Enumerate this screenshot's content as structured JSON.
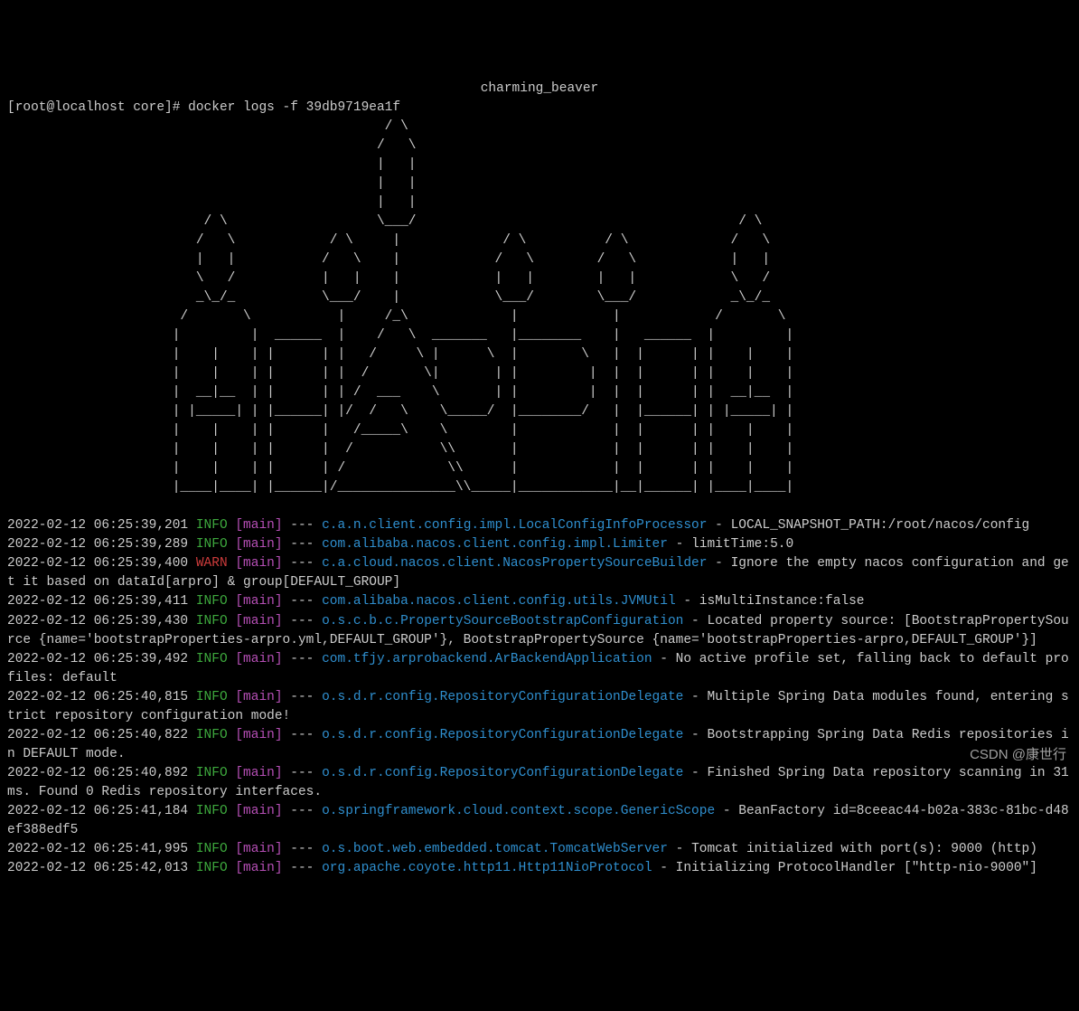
{
  "header_name": "charming_beaver",
  "prompt_left": "[root@localhost core]#",
  "prompt_cmd": "docker logs -f 39db9719ea1f",
  "ascii_art": "                                                / \\\n                                               /   \\\n                                               |   |\n                                               |   |\n                                               |   |\n                         / \\                   \\___/                                         / \\\n                        /   \\            / \\     |             / \\          / \\             /   \\\n                        |   |           /   \\    |            /   \\        /   \\            |   |\n                        \\   /           |   |    |            |   |        |   |            \\   /\n                        _\\_/_           \\___/    |            \\___/        \\___/            _\\_/_\n                      /       \\           |     /_\\             |            |            /       \\\n                     |         |  ______  |    /   \\  _______   |________    |   ______  |         |\n                     |    |    | |      | |   /     \\ |      \\  |        \\   |  |      | |    |    |\n                     |    |    | |      | |  /       \\|       | |         |  |  |      | |    |    |\n                     |  __|__  | |      | | /  ___    \\       | |         |  |  |      | |  __|__  |\n                     | |_____| | |______| |/  /   \\    \\_____/  |________/   |  |______| | |_____| |\n                     |    |    | |      |   /_____\\    \\        |            |  |      | |    |    |\n                     |    |    | |      |  /           \\\\       |            |  |      | |    |    |\n                     |    |    | |      | /             \\\\      |            |  |      | |    |    |\n                     |____|____| |______|/_______________\\\\_____|____________|__|______| |____|____|",
  "logs": [
    {
      "ts": "2022-02-12 06:25:39,201",
      "level": "INFO",
      "thread": "[main]",
      "sep": " --- ",
      "logger": "c.a.n.client.config.impl.LocalConfigInfoProcessor",
      "msg": " - LOCAL_SNAPSHOT_PATH:/root/nacos/config"
    },
    {
      "ts": "2022-02-12 06:25:39,289",
      "level": "INFO",
      "thread": "[main]",
      "sep": " --- ",
      "logger": "com.alibaba.nacos.client.config.impl.Limiter",
      "msg": " - limitTime:5.0"
    },
    {
      "ts": "2022-02-12 06:25:39,400",
      "level": "WARN",
      "thread": "[main]",
      "sep": " --- ",
      "logger": "c.a.cloud.nacos.client.NacosPropertySourceBuilder",
      "msg": " - Ignore the empty nacos configuration and get it based on dataId[arpro] & group[DEFAULT_GROUP]"
    },
    {
      "ts": "2022-02-12 06:25:39,411",
      "level": "INFO",
      "thread": "[main]",
      "sep": " --- ",
      "logger": "com.alibaba.nacos.client.config.utils.JVMUtil",
      "msg": " - isMultiInstance:false"
    },
    {
      "ts": "2022-02-12 06:25:39,430",
      "level": "INFO",
      "thread": "[main]",
      "sep": " --- ",
      "logger": "o.s.c.b.c.PropertySourceBootstrapConfiguration",
      "msg": " - Located property source: [BootstrapPropertySource {name='bootstrapProperties-arpro.yml,DEFAULT_GROUP'}, BootstrapPropertySource {name='bootstrapProperties-arpro,DEFAULT_GROUP'}]"
    },
    {
      "ts": "2022-02-12 06:25:39,492",
      "level": "INFO",
      "thread": "[main]",
      "sep": " --- ",
      "logger": "com.tfjy.arprobackend.ArBackendApplication",
      "msg": " - No active profile set, falling back to default profiles: default"
    },
    {
      "ts": "2022-02-12 06:25:40,815",
      "level": "INFO",
      "thread": "[main]",
      "sep": " --- ",
      "logger": "o.s.d.r.config.RepositoryConfigurationDelegate",
      "msg": " - Multiple Spring Data modules found, entering strict repository configuration mode!"
    },
    {
      "ts": "2022-02-12 06:25:40,822",
      "level": "INFO",
      "thread": "[main]",
      "sep": " --- ",
      "logger": "o.s.d.r.config.RepositoryConfigurationDelegate",
      "msg": " - Bootstrapping Spring Data Redis repositories in DEFAULT mode."
    },
    {
      "ts": "2022-02-12 06:25:40,892",
      "level": "INFO",
      "thread": "[main]",
      "sep": " --- ",
      "logger": "o.s.d.r.config.RepositoryConfigurationDelegate",
      "msg": " - Finished Spring Data repository scanning in 31ms. Found 0 Redis repository interfaces."
    },
    {
      "ts": "2022-02-12 06:25:41,184",
      "level": "INFO",
      "thread": "[main]",
      "sep": " --- ",
      "logger": "o.springframework.cloud.context.scope.GenericScope",
      "msg": " - BeanFactory id=8ceeac44-b02a-383c-81bc-d48ef388edf5"
    },
    {
      "ts": "2022-02-12 06:25:41,995",
      "level": "INFO",
      "thread": "[main]",
      "sep": " --- ",
      "logger": "o.s.boot.web.embedded.tomcat.TomcatWebServer",
      "msg": " - Tomcat initialized with port(s): 9000 (http)"
    },
    {
      "ts": "2022-02-12 06:25:42,013",
      "level": "INFO",
      "thread": "[main]",
      "sep": " --- ",
      "logger": "org.apache.coyote.http11.Http11NioProtocol",
      "msg": " - Initializing ProtocolHandler [\"http-nio-9000\"]"
    }
  ],
  "watermark": "CSDN @康世行"
}
